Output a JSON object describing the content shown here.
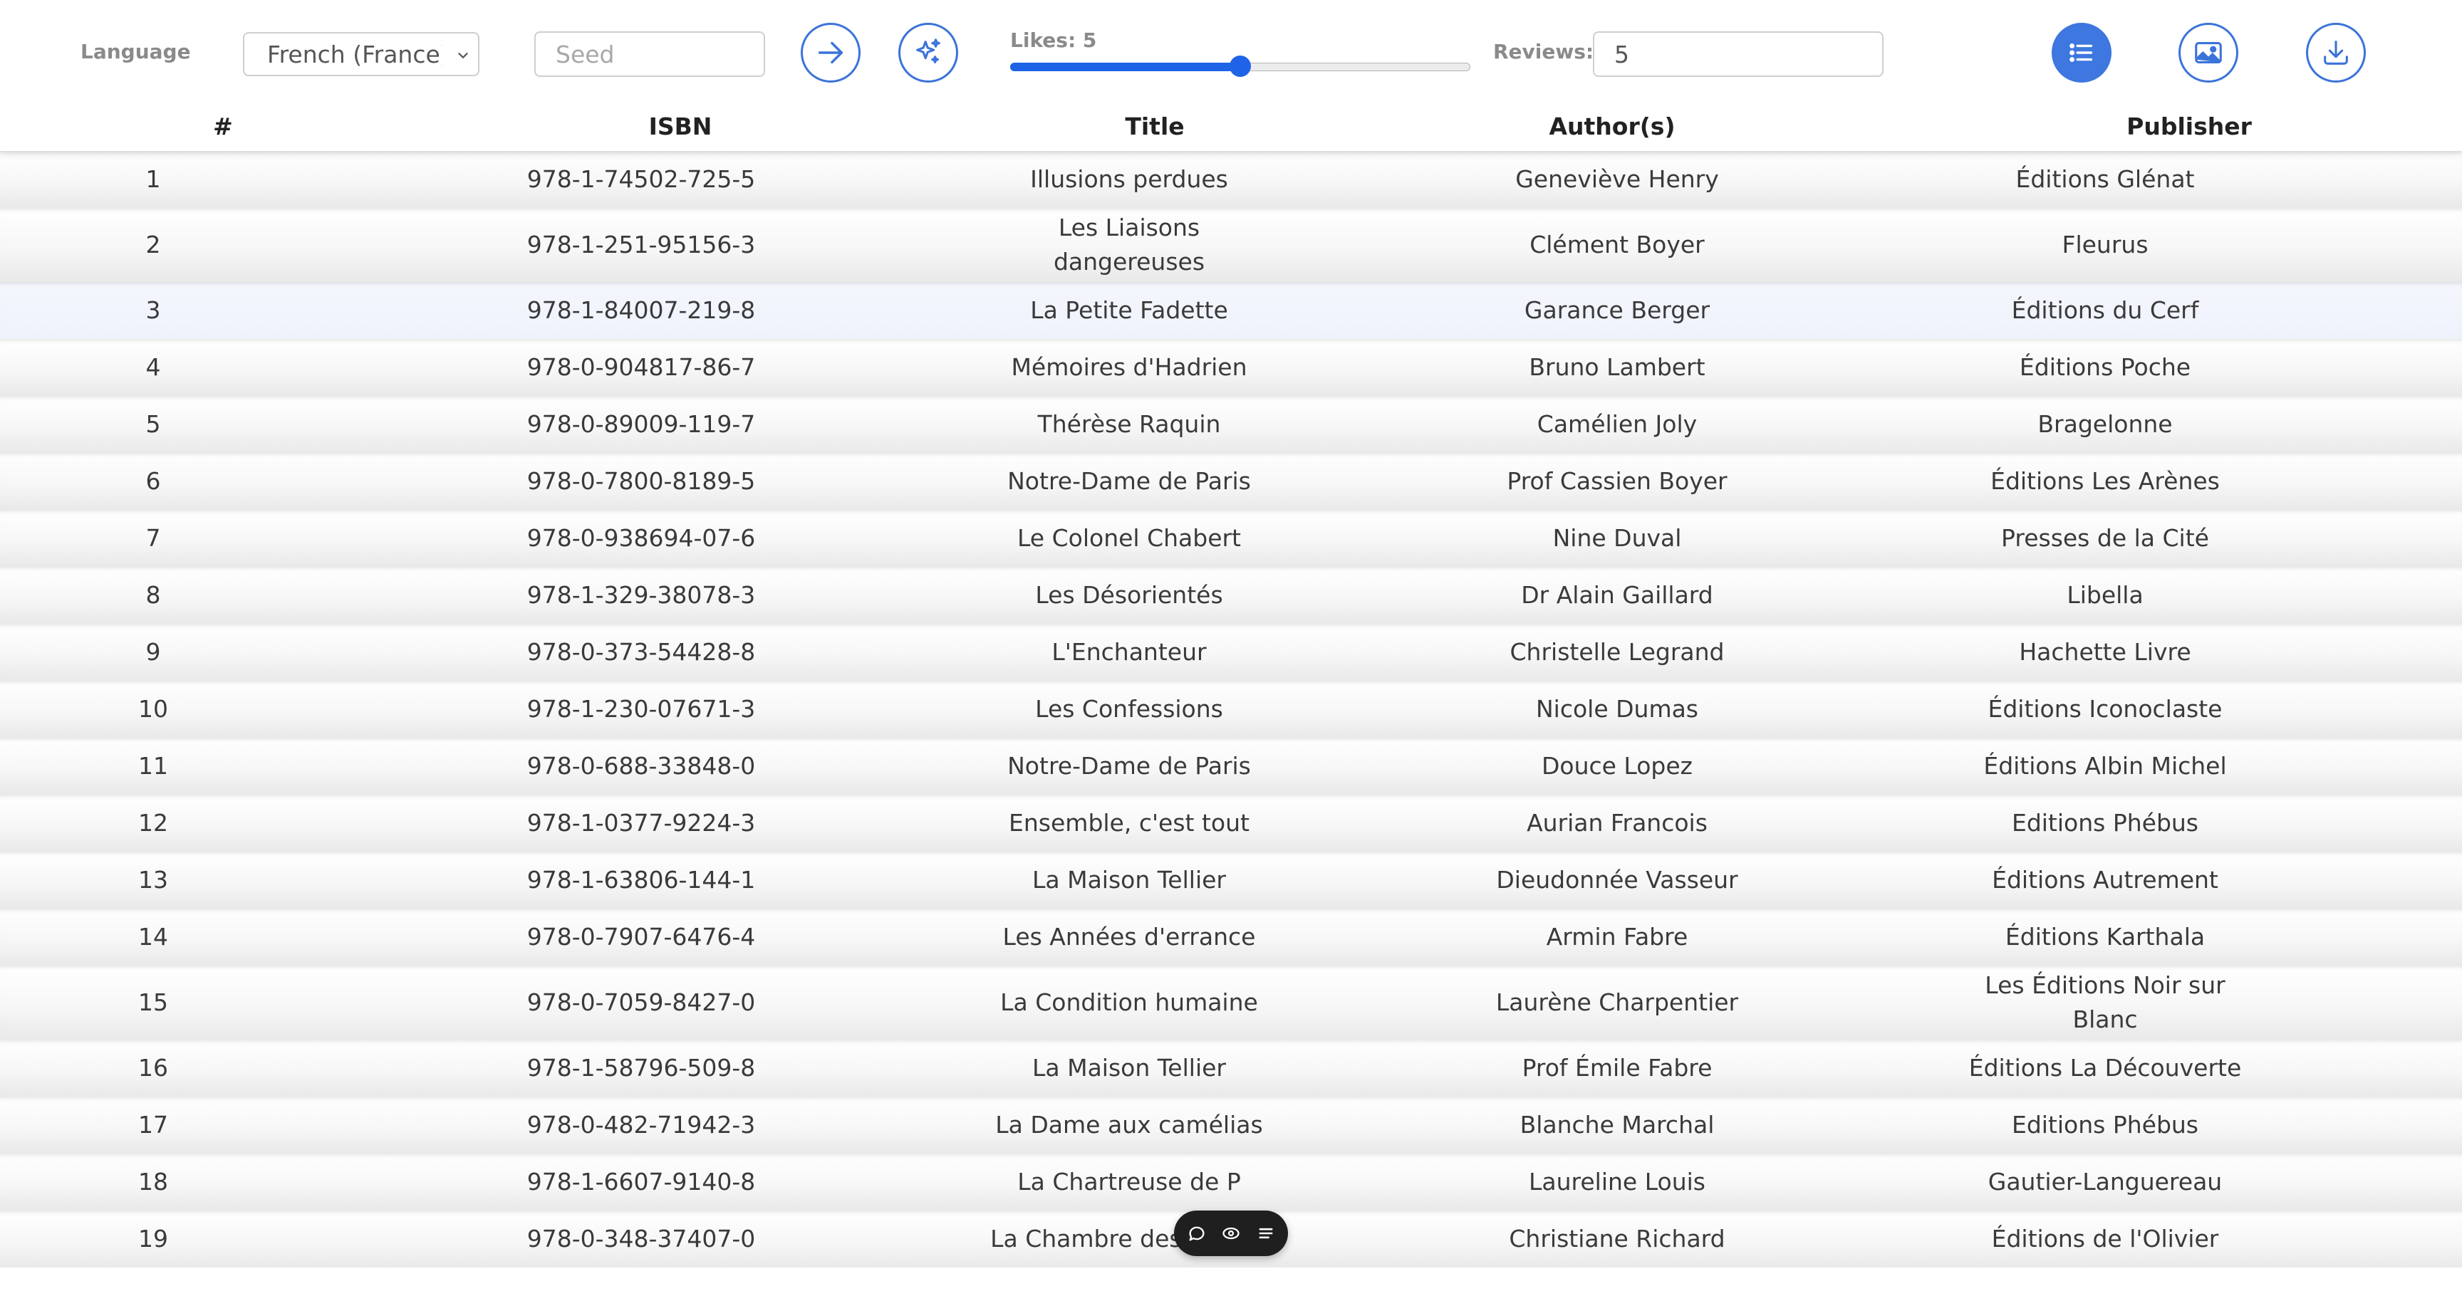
{
  "toolbar": {
    "language_label": "Language",
    "language_value": "French (France)",
    "seed_placeholder": "Seed",
    "seed_value": "",
    "likes_label": "Likes: 5",
    "likes_value": 5,
    "likes_max": 10,
    "reviews_label": "Reviews:",
    "reviews_value": "5",
    "icons": {
      "next": "arrow-right-icon",
      "random": "sparkles-icon",
      "list_view": "list-icon",
      "gallery_view": "image-icon",
      "export": "download-icon"
    },
    "accent_color": "#3d77df"
  },
  "table": {
    "headers": [
      "#",
      "ISBN",
      "Title",
      "Author(s)",
      "Publisher"
    ],
    "rows": [
      {
        "num": "1",
        "isbn": "978-1-74502-725-5",
        "title": "Illusions perdues",
        "author": "Geneviève Henry",
        "publisher": "Éditions Glénat"
      },
      {
        "num": "2",
        "isbn": "978-1-251-95156-3",
        "title": "Les Liaisons dangereuses",
        "author": "Clément Boyer",
        "publisher": "Fleurus"
      },
      {
        "num": "3",
        "isbn": "978-1-84007-219-8",
        "title": "La Petite Fadette",
        "author": "Garance Berger",
        "publisher": "Éditions du Cerf"
      },
      {
        "num": "4",
        "isbn": "978-0-904817-86-7",
        "title": "Mémoires d'Hadrien",
        "author": "Bruno Lambert",
        "publisher": "Éditions Poche"
      },
      {
        "num": "5",
        "isbn": "978-0-89009-119-7",
        "title": "Thérèse Raquin",
        "author": "Camélien Joly",
        "publisher": "Bragelonne"
      },
      {
        "num": "6",
        "isbn": "978-0-7800-8189-5",
        "title": "Notre-Dame de Paris",
        "author": "Prof Cassien Boyer",
        "publisher": "Éditions Les Arènes"
      },
      {
        "num": "7",
        "isbn": "978-0-938694-07-6",
        "title": "Le Colonel Chabert",
        "author": "Nine Duval",
        "publisher": "Presses de la Cité"
      },
      {
        "num": "8",
        "isbn": "978-1-329-38078-3",
        "title": "Les Désorientés",
        "author": "Dr Alain Gaillard",
        "publisher": "Libella"
      },
      {
        "num": "9",
        "isbn": "978-0-373-54428-8",
        "title": "L'Enchanteur",
        "author": "Christelle Legrand",
        "publisher": "Hachette Livre"
      },
      {
        "num": "10",
        "isbn": "978-1-230-07671-3",
        "title": "Les Confessions",
        "author": "Nicole Dumas",
        "publisher": "Éditions Iconoclaste"
      },
      {
        "num": "11",
        "isbn": "978-0-688-33848-0",
        "title": "Notre-Dame de Paris",
        "author": "Douce Lopez",
        "publisher": "Éditions Albin Michel"
      },
      {
        "num": "12",
        "isbn": "978-1-0377-9224-3",
        "title": "Ensemble, c'est tout",
        "author": "Aurian Francois",
        "publisher": "Editions Phébus"
      },
      {
        "num": "13",
        "isbn": "978-1-63806-144-1",
        "title": "La Maison Tellier",
        "author": "Dieudonnée Vasseur",
        "publisher": "Éditions Autrement"
      },
      {
        "num": "14",
        "isbn": "978-0-7907-6476-4",
        "title": "Les Années d'errance",
        "author": "Armin Fabre",
        "publisher": "Éditions Karthala"
      },
      {
        "num": "15",
        "isbn": "978-0-7059-8427-0",
        "title": "La Condition humaine",
        "author": "Laurène Charpentier",
        "publisher": "Les Éditions Noir sur Blanc"
      },
      {
        "num": "16",
        "isbn": "978-1-58796-509-8",
        "title": "La Maison Tellier",
        "author": "Prof Émile Fabre",
        "publisher": "Éditions La Découverte"
      },
      {
        "num": "17",
        "isbn": "978-0-482-71942-3",
        "title": "La Dame aux camélias",
        "author": "Blanche Marchal",
        "publisher": "Editions Phébus"
      },
      {
        "num": "18",
        "isbn": "978-1-6607-9140-8",
        "title": "La Chartreuse de P",
        "author": "Laureline Louis",
        "publisher": "Gautier-Languereau"
      },
      {
        "num": "19",
        "isbn": "978-0-348-37407-0",
        "title": "La Chambre des dames",
        "author": "Christiane Richard",
        "publisher": "Éditions de l'Olivier"
      }
    ]
  },
  "floating_bar": {
    "icons": [
      "comment-icon",
      "eye-icon",
      "menu-icon"
    ]
  }
}
